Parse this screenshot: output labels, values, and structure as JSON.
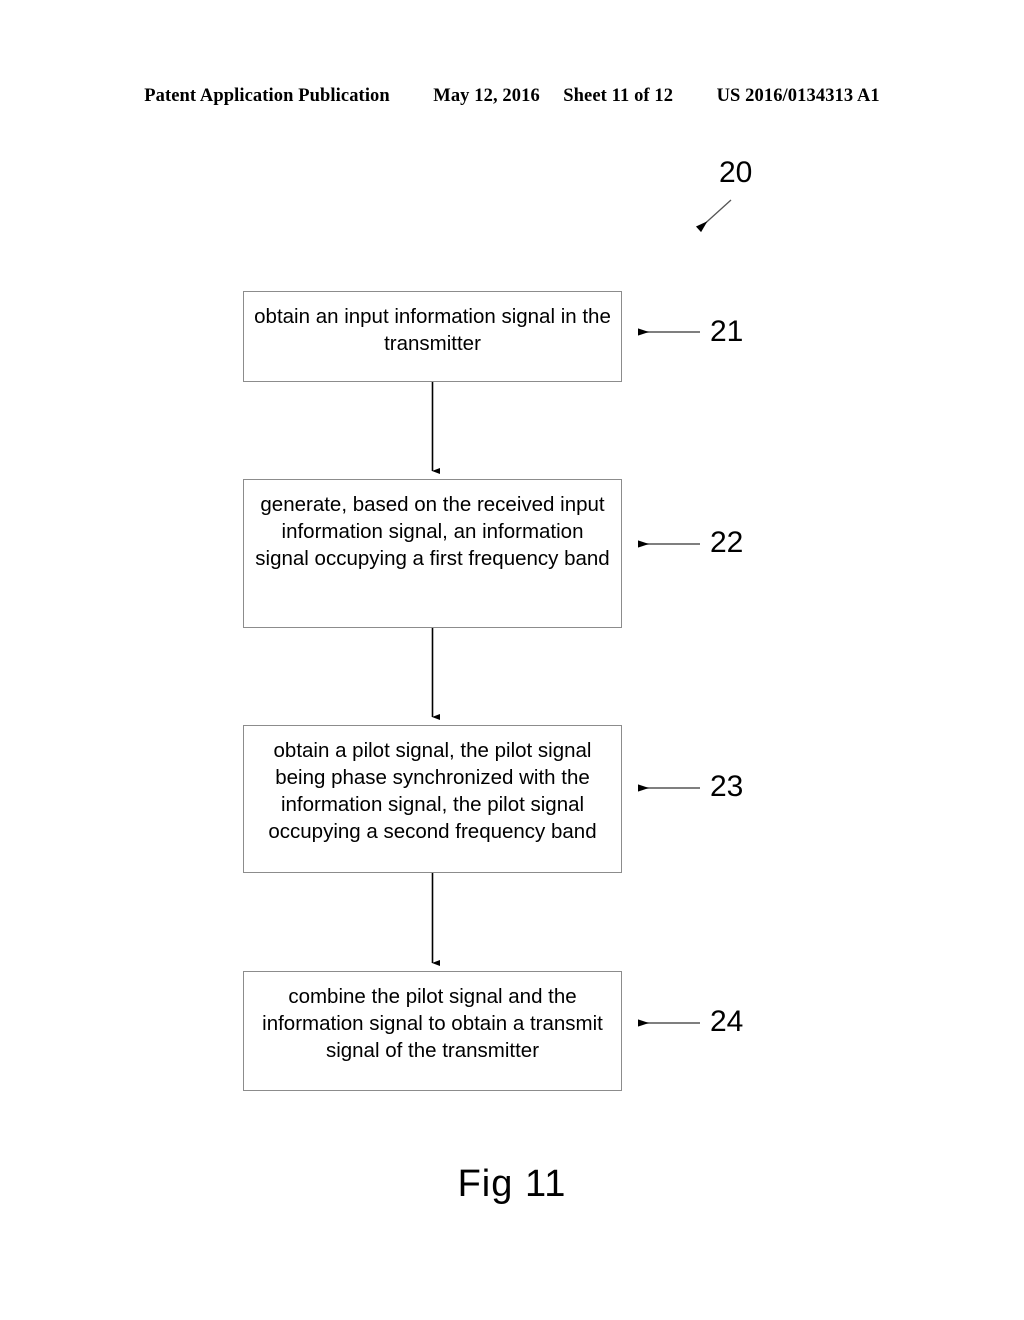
{
  "header": {
    "publication": "Patent Application Publication",
    "date": "May 12, 2016",
    "sheet": "Sheet 11 of 12",
    "patent_number": "US 2016/0134313 A1"
  },
  "figure": {
    "caption": "Fig 11",
    "overall_ref": "20",
    "steps": [
      {
        "ref": "21",
        "text": "obtain an input information signal in the transmitter"
      },
      {
        "ref": "22",
        "text": "generate, based on the received input information signal, an information signal occupying a first frequency band"
      },
      {
        "ref": "23",
        "text": "obtain a pilot signal, the pilot signal being phase synchronized with the information signal, the pilot signal occupying a second frequency band"
      },
      {
        "ref": "24",
        "text": "combine the pilot signal and the information signal to obtain a transmit signal of the transmitter"
      }
    ]
  },
  "colors": {
    "box_border": "#8c8c8c",
    "connector": "#000000",
    "leader": "#000000",
    "text": "#000000",
    "background": "#ffffff"
  }
}
